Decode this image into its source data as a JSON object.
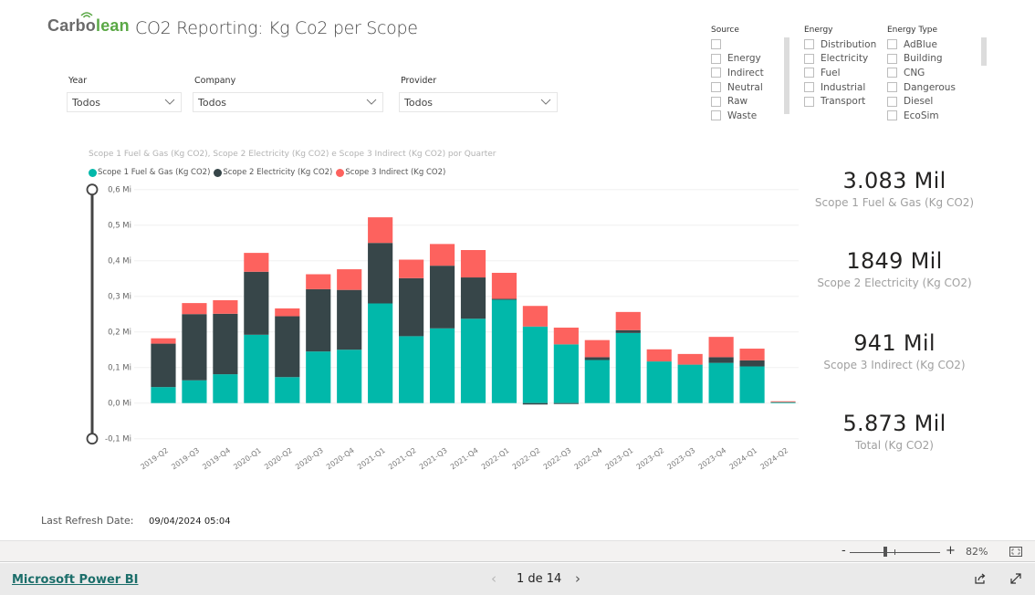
{
  "header": {
    "logo_part1": "Carbo",
    "logo_part2": "lean",
    "title": "CO2 Reporting: Kg Co2 per Scope"
  },
  "slicers": {
    "year": {
      "label": "Year",
      "value": "Todos"
    },
    "company": {
      "label": "Company",
      "value": "Todos"
    },
    "provider": {
      "label": "Provider",
      "value": "Todos"
    }
  },
  "lists": {
    "source": {
      "label": "Source",
      "items": [
        "",
        "Energy",
        "Indirect",
        "Neutral",
        "Raw",
        "Waste"
      ]
    },
    "energy": {
      "label": "Energy",
      "items": [
        "Distribution",
        "Electricity",
        "Fuel",
        "Industrial",
        "Transport"
      ]
    },
    "energy_type": {
      "label": "Energy Type",
      "items": [
        "AdBlue",
        "Building",
        "CNG",
        "Dangerous",
        "Diesel",
        "EcoSim"
      ]
    }
  },
  "colors": {
    "scope1": "#01b8aa",
    "scope2": "#374649",
    "scope3": "#fd625e"
  },
  "chart_data": {
    "type": "bar",
    "stacked": true,
    "title": "Scope 1 Fuel & Gas (Kg CO2), Scope 2 Electricity (Kg CO2) e Scope 3 Indirect (Kg CO2) por Quarter",
    "xlabel": "",
    "ylabel": "",
    "ylim": [
      -0.1,
      0.6
    ],
    "yunit": "Mi",
    "yticks": [
      "0,6 Mi",
      "0,5 Mi",
      "0,4 Mi",
      "0,3 Mi",
      "0,2 Mi",
      "0,1 Mi",
      "0,0 Mi",
      "-0,1 Mi"
    ],
    "ytick_values": [
      0.6,
      0.5,
      0.4,
      0.3,
      0.2,
      0.1,
      0.0,
      -0.1
    ],
    "grid": true,
    "legend_position": "top-left",
    "categories": [
      "2019-Q2",
      "2019-Q3",
      "2019-Q4",
      "2020-Q1",
      "2020-Q2",
      "2020-Q3",
      "2020-Q4",
      "2021-Q1",
      "2021-Q2",
      "2021-Q3",
      "2021-Q4",
      "2022-Q1",
      "2022-Q2",
      "2022-Q3",
      "2022-Q4",
      "2023-Q1",
      "2023-Q2",
      "2023-Q3",
      "2023-Q4",
      "2024-Q1",
      "2024-Q2"
    ],
    "series": [
      {
        "name": "Scope 1 Fuel & Gas (Kg CO2)",
        "values": [
          0.045,
          0.064,
          0.081,
          0.192,
          0.073,
          0.145,
          0.15,
          0.28,
          0.188,
          0.21,
          0.237,
          0.291,
          0.215,
          0.165,
          0.121,
          0.197,
          0.117,
          0.108,
          0.113,
          0.103,
          0.003
        ]
      },
      {
        "name": "Scope 2 Electricity (Kg CO2)",
        "values": [
          0.122,
          0.186,
          0.17,
          0.177,
          0.171,
          0.175,
          0.168,
          0.17,
          0.163,
          0.176,
          0.116,
          0.002,
          -0.004,
          -0.002,
          0.008,
          0.008,
          0.0,
          0.0,
          0.016,
          0.017,
          0.0
        ]
      },
      {
        "name": "Scope 3 Indirect (Kg CO2)",
        "values": [
          0.015,
          0.031,
          0.038,
          0.053,
          0.022,
          0.042,
          0.058,
          0.072,
          0.052,
          0.061,
          0.077,
          0.073,
          0.058,
          0.047,
          0.048,
          0.051,
          0.034,
          0.03,
          0.057,
          0.033,
          0.002
        ]
      }
    ]
  },
  "kpis": [
    {
      "value": "3.083 Mil",
      "label": "Scope 1 Fuel & Gas (Kg CO2)"
    },
    {
      "value": "1849 Mil",
      "label": "Scope 2 Electricity (Kg CO2)"
    },
    {
      "value": "941 Mil",
      "label": "Scope 3 Indirect (Kg CO2)"
    },
    {
      "value": "5.873 Mil",
      "label": "Total (Kg CO2)"
    }
  ],
  "refresh": {
    "label": "Last Refresh Date:",
    "value": "09/04/2024 05:04"
  },
  "zoom": {
    "minus": "-",
    "plus": "+",
    "level": "82%"
  },
  "footer": {
    "brand": "Microsoft Power BI",
    "prev": "‹",
    "next": "›",
    "pager": "1 de 14"
  }
}
